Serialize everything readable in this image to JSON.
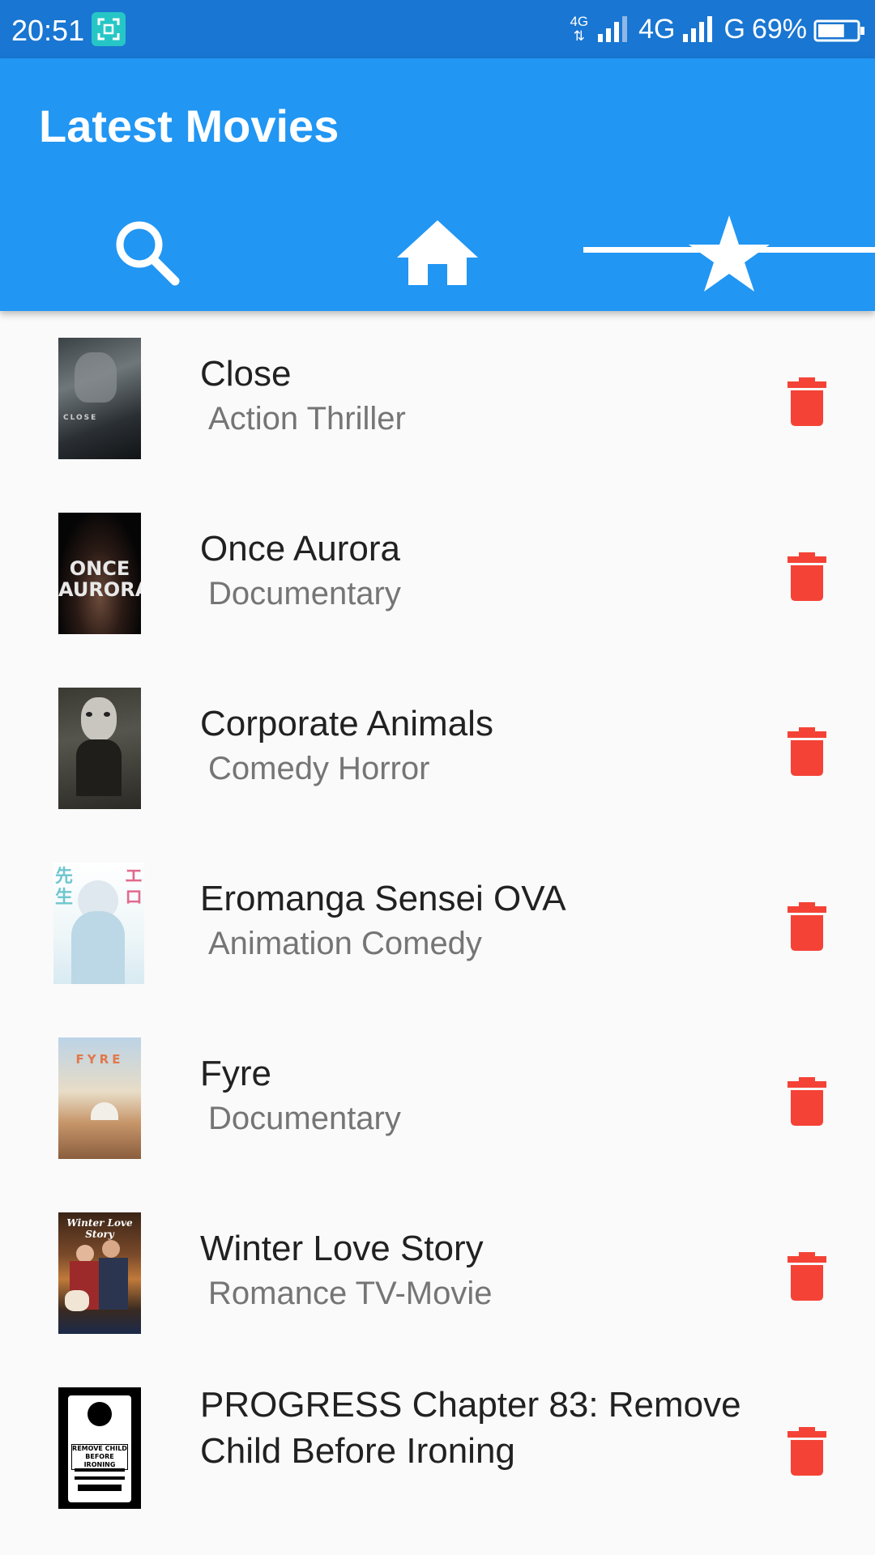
{
  "status_bar": {
    "time": "20:51",
    "network1_top": "4G",
    "network2": "4G",
    "network3": "G",
    "battery": "69%",
    "battery_level": 0.69
  },
  "app_bar": {
    "title": "Latest Movies",
    "tabs": [
      {
        "icon": "search-icon",
        "selected": false
      },
      {
        "icon": "home-icon",
        "selected": false
      },
      {
        "icon": "star-icon",
        "selected": true
      }
    ]
  },
  "colors": {
    "status_bar": "#1976d2",
    "app_bar": "#2196f3",
    "delete": "#f44336",
    "title_text": "#212121",
    "genre_text": "#757575"
  },
  "movies": [
    {
      "title": "Close",
      "genre": "Action Thriller",
      "poster_text": "CLOSE"
    },
    {
      "title": "Once Aurora",
      "genre": "Documentary",
      "poster_text": "ONCE AURORA"
    },
    {
      "title": "Corporate Animals",
      "genre": "Comedy Horror",
      "poster_text": ""
    },
    {
      "title": "Eromanga Sensei OVA",
      "genre": "Animation Comedy",
      "poster_text": "エロマンガ先生"
    },
    {
      "title": "Fyre",
      "genre": "Documentary",
      "poster_text": "FYRE"
    },
    {
      "title": "Winter Love Story",
      "genre": "Romance TV-Movie",
      "poster_text": "Winter Love Story"
    },
    {
      "title": "PROGRESS Chapter 83: Remove Child Before Ironing",
      "genre": "",
      "poster_text": "REMOVE CHILD BEFORE IRONING"
    }
  ]
}
